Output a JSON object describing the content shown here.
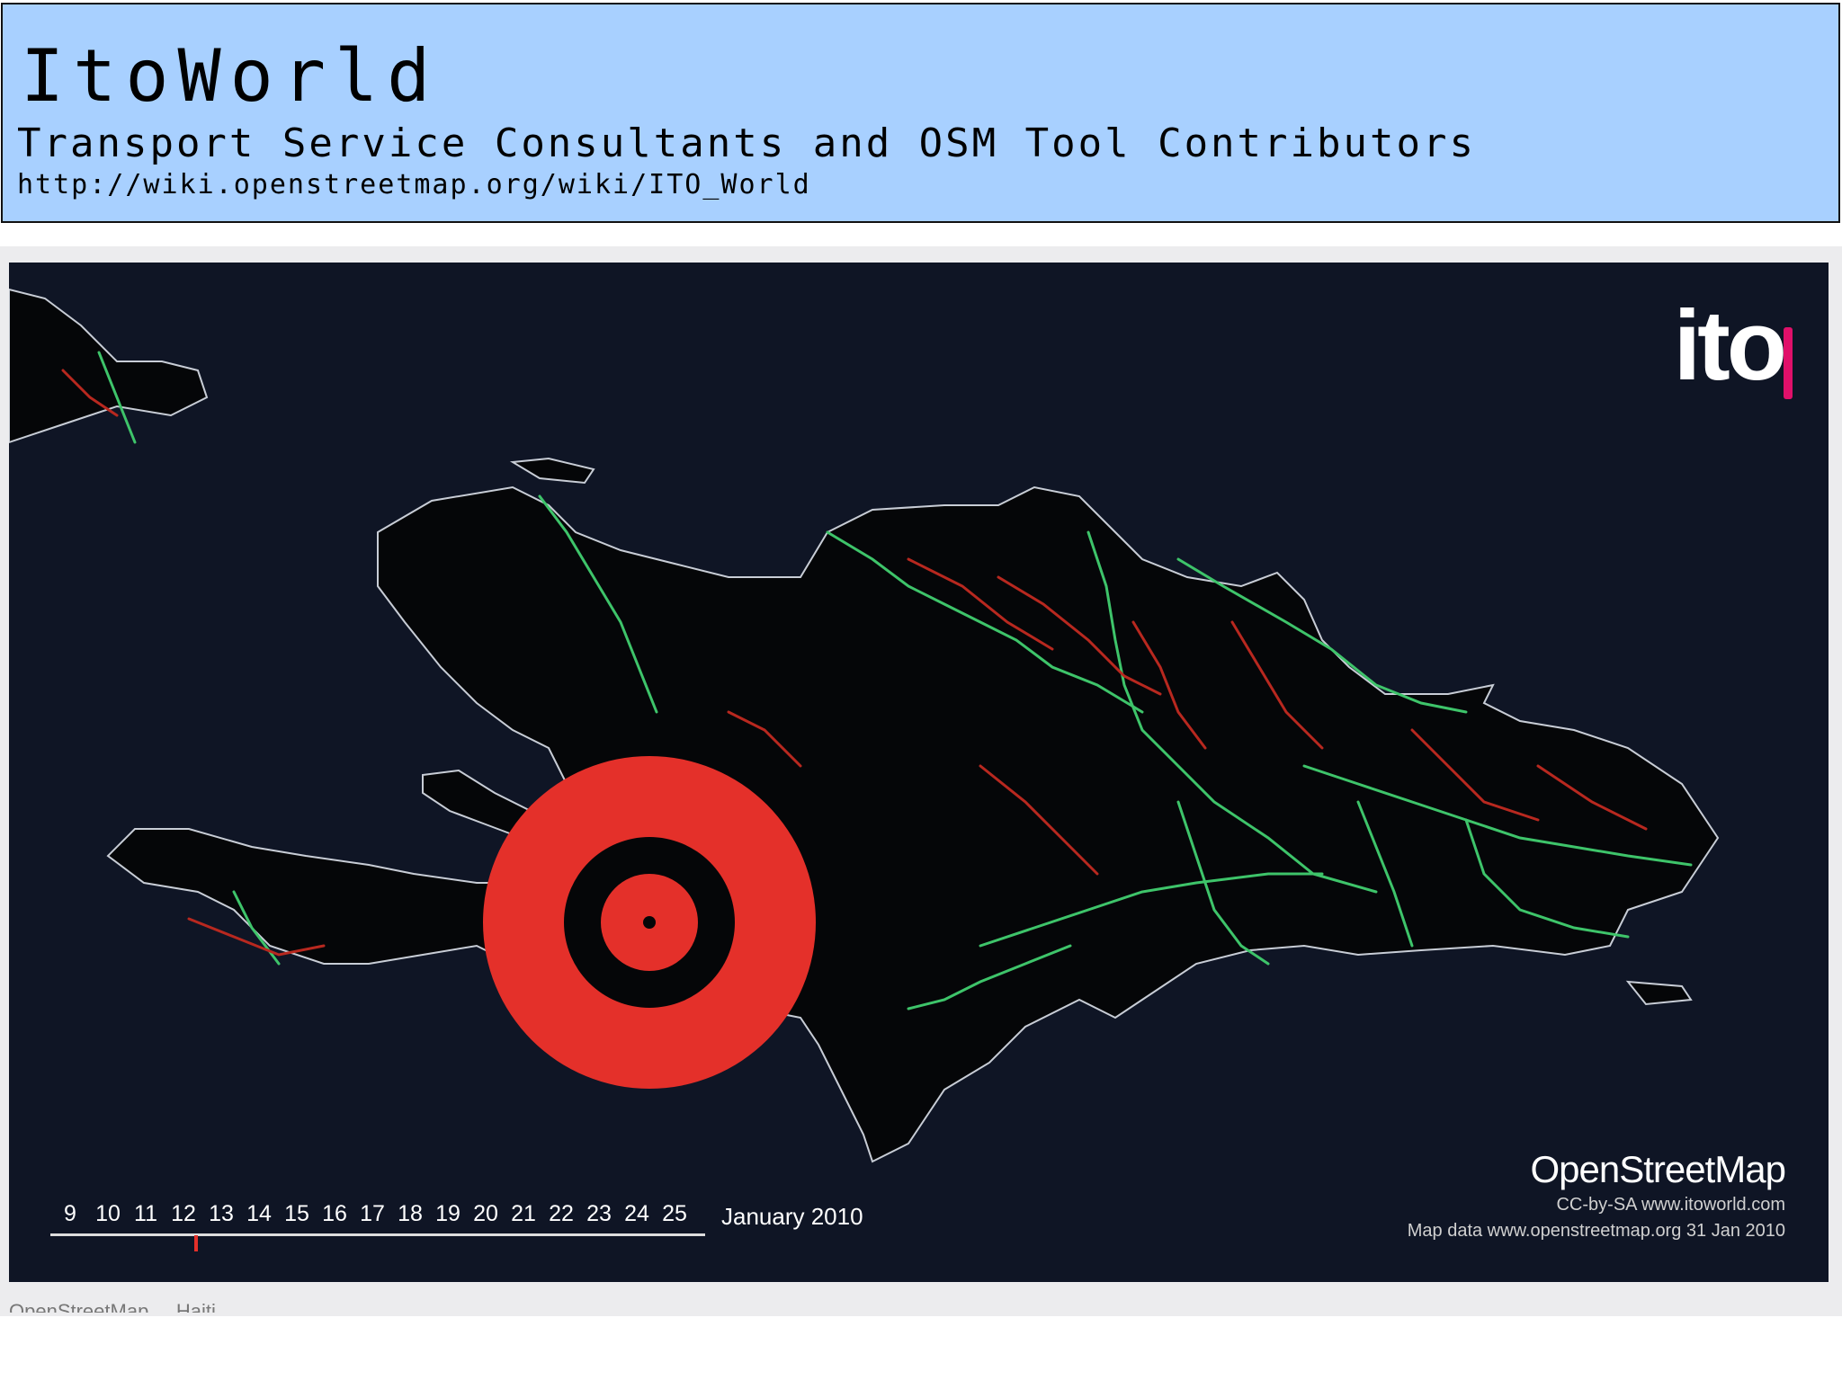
{
  "header": {
    "title": "ItoWorld",
    "subtitle": "Transport Service Consultants and OSM Tool Contributors",
    "url": "http://wiki.openstreetmap.org/wiki/ITO_World"
  },
  "video": {
    "logo_text": "ito",
    "logo_accent_color": "#e0106a",
    "brand": "OpenStreetMap",
    "credit_line_1": "CC-by-SA www.itoworld.com",
    "credit_line_2": "Map data www.openstreetmap.org 31 Jan 2010",
    "timeline": {
      "days": [
        "9",
        "10",
        "11",
        "12",
        "13",
        "14",
        "15",
        "16",
        "17",
        "18",
        "19",
        "20",
        "21",
        "22",
        "23",
        "24",
        "25"
      ],
      "month": "January 2010",
      "current_day": "12"
    },
    "colors": {
      "sea": "#0f1525",
      "land": "#050608",
      "coast": "#c8cdd6",
      "road_new": "#3ec46a",
      "road_old": "#b8281f",
      "target": "#e4302a"
    }
  },
  "caption": "OpenStreetMap ... Haiti ..."
}
